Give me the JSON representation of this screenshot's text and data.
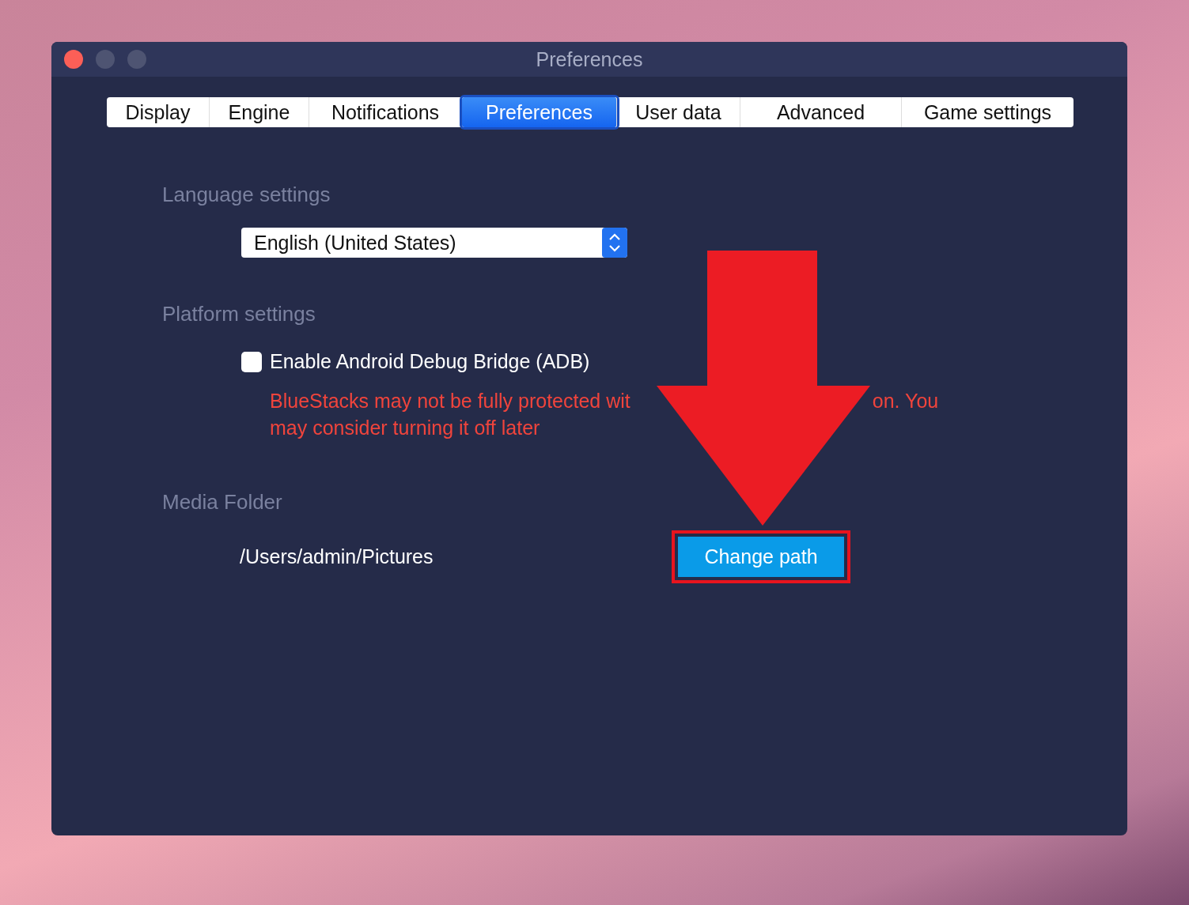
{
  "window": {
    "title": "Preferences"
  },
  "tabs": [
    {
      "label": "Display",
      "selected": false
    },
    {
      "label": "Engine",
      "selected": false
    },
    {
      "label": "Notifications",
      "selected": false
    },
    {
      "label": "Preferences",
      "selected": true
    },
    {
      "label": "User data",
      "selected": false
    },
    {
      "label": "Advanced",
      "selected": false
    },
    {
      "label": "Game settings",
      "selected": false
    }
  ],
  "language_settings": {
    "heading": "Language settings",
    "dropdown_value": "English (United States)"
  },
  "platform_settings": {
    "heading": "Platform settings",
    "adb_checkbox": {
      "label": "Enable Android Debug Bridge (ADB)",
      "checked": false
    },
    "warning_visible_parts": [
      "BlueStacks may not be fully protected wit",
      "on. You",
      "may consider turning it off later"
    ]
  },
  "media_folder": {
    "heading": "Media Folder",
    "path": "/Users/admin/Pictures",
    "button": "Change path",
    "highlighted": true
  }
}
